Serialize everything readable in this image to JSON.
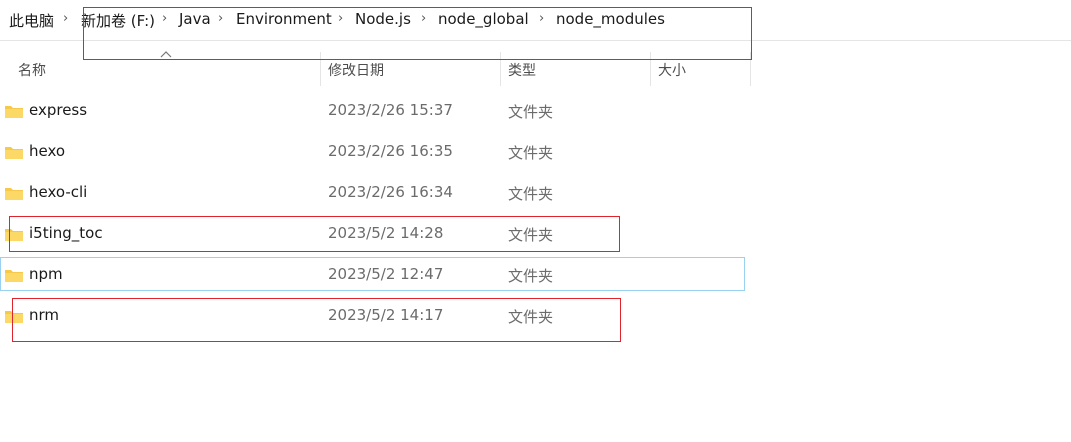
{
  "breadcrumb": {
    "items": [
      "此电脑",
      "新加卷 (F:)",
      "Java",
      "Environment",
      "Node.js",
      "node_global",
      "node_modules"
    ],
    "separator": "›"
  },
  "columns": {
    "name": "名称",
    "date": "修改日期",
    "type": "类型",
    "size": "大小"
  },
  "files": [
    {
      "name": "express",
      "date": "2023/2/26 15:37",
      "type": "文件夹"
    },
    {
      "name": "hexo",
      "date": "2023/2/26 16:35",
      "type": "文件夹"
    },
    {
      "name": "hexo-cli",
      "date": "2023/2/26 16:34",
      "type": "文件夹"
    },
    {
      "name": "i5ting_toc",
      "date": "2023/5/2 14:28",
      "type": "文件夹"
    },
    {
      "name": "npm",
      "date": "2023/5/2 12:47",
      "type": "文件夹"
    },
    {
      "name": "nrm",
      "date": "2023/5/2 14:17",
      "type": "文件夹"
    }
  ],
  "icons": {
    "folder": "folder-icon",
    "separator": "chevron-right-icon",
    "sort": "sort-caret-icon"
  },
  "colors": {
    "annotation": "#e0242c",
    "hover_outline": "#99d1f0",
    "folder": "#f6c94a"
  }
}
